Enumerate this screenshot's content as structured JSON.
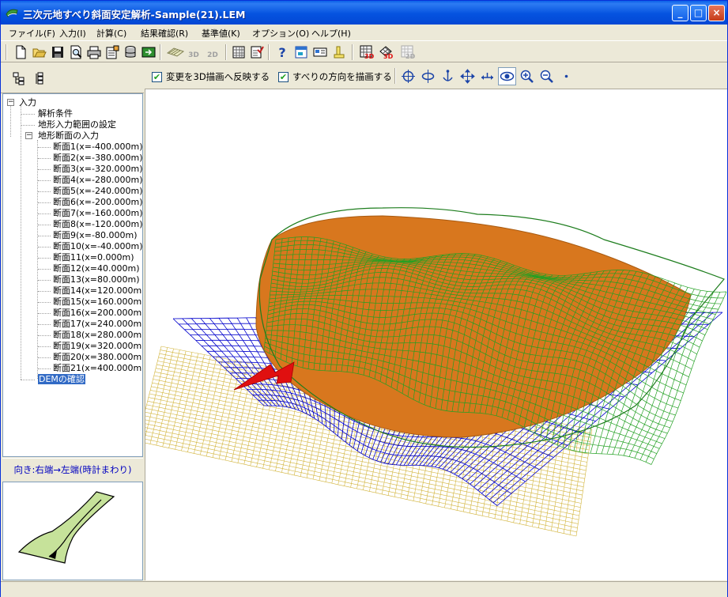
{
  "window": {
    "title": "三次元地すべり斜面安定解析-Sample(21).LEM"
  },
  "menu": [
    "ファイル(F)",
    "入力(I)",
    "計算(C)",
    "結果確認(R)",
    "基準値(K)",
    "オプション(O)",
    "ヘルプ(H)"
  ],
  "toolbar": {
    "icons": [
      "new-file-icon",
      "open-folder-icon",
      "save-disk-icon",
      "print-preview-icon",
      "print-icon",
      "data-sheet-icon",
      "database-icon",
      "export-icon",
      "view-3d-icon",
      "view-2d-icon",
      "grid-icon",
      "check-list-icon",
      "help-icon",
      "window-icon",
      "card-icon",
      "notice-icon",
      "mesh-3d-icon",
      "mesh-3d-alt-icon",
      "mesh-2d-icon"
    ],
    "labels": {
      "v3d": "3D",
      "v2d": "2D",
      "m3d": "3D",
      "m3d2": "3D",
      "m2d": "2D"
    }
  },
  "view_options": {
    "reflect_3d": {
      "label": "変更を3D描画へ反映する",
      "checked": true
    },
    "draw_direction": {
      "label": "すべりの方向を描画する",
      "checked": true
    }
  },
  "tree": {
    "root": "入力",
    "items": [
      "解析条件",
      "地形入力範囲の設定",
      "地形断面の入力"
    ],
    "sections": [
      "断面1(x=-400.000m)",
      "断面2(x=-380.000m)",
      "断面3(x=-320.000m)",
      "断面4(x=-280.000m)",
      "断面5(x=-240.000m)",
      "断面6(x=-200.000m)",
      "断面7(x=-160.000m)",
      "断面8(x=-120.000m)",
      "断面9(x=-80.000m)",
      "断面10(x=-40.000m)",
      "断面11(x=0.000m)",
      "断面12(x=40.000m)",
      "断面13(x=80.000m)",
      "断面14(x=120.000m)",
      "断面15(x=160.000m)",
      "断面16(x=200.000m)",
      "断面17(x=240.000m)",
      "断面18(x=280.000m)",
      "断面19(x=320.000m)",
      "断面20(x=380.000m)",
      "断面21(x=400.000m)"
    ],
    "selected": "DEMの確認"
  },
  "direction": {
    "label": "向き:右端→左端(時計まわり)"
  },
  "colors": {
    "terrain": "#22a022",
    "slip": "#d8771e",
    "grid": "#0000cc",
    "base": "#d2b43c",
    "arrow": "#e01010"
  }
}
